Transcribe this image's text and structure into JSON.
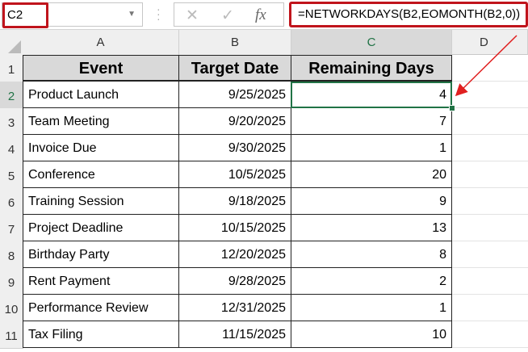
{
  "name_box": {
    "value": "C2"
  },
  "formula_bar": {
    "cancel_icon": "✕",
    "enter_icon": "✓",
    "fx_label": "fx",
    "formula": "=NETWORKDAYS(B2,EOMONTH(B2,0))"
  },
  "columns": [
    "A",
    "B",
    "C",
    "D"
  ],
  "rows": [
    "1",
    "2",
    "3",
    "4",
    "5",
    "6",
    "7",
    "8",
    "9",
    "10",
    "11"
  ],
  "table": {
    "headers": [
      "Event",
      "Target Date",
      "Remaining Days"
    ],
    "data": [
      [
        "Product Launch",
        "9/25/2025",
        "4"
      ],
      [
        "Team Meeting",
        "9/20/2025",
        "7"
      ],
      [
        "Invoice Due",
        "9/30/2025",
        "1"
      ],
      [
        "Conference",
        "10/5/2025",
        "20"
      ],
      [
        "Training Session",
        "9/18/2025",
        "9"
      ],
      [
        "Project Deadline",
        "10/15/2025",
        "13"
      ],
      [
        "Birthday Party",
        "12/20/2025",
        "8"
      ],
      [
        "Rent Payment",
        "9/28/2025",
        "2"
      ],
      [
        "Performance Review",
        "12/31/2025",
        "1"
      ],
      [
        "Tax Filing",
        "11/15/2025",
        "10"
      ]
    ]
  },
  "colors": {
    "highlight": "#c0141c",
    "selection": "#217346",
    "header_fill": "#d9d9d9"
  }
}
